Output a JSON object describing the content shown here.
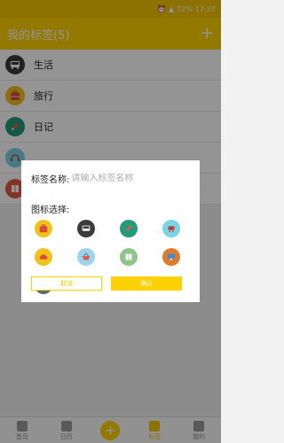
{
  "status_bar": {
    "battery": "72%",
    "time": "17:27"
  },
  "app_bar": {
    "title": "我的标签(5)",
    "add_icon": "+"
  },
  "tags": [
    {
      "label": "生活",
      "icon": "bus-icon",
      "color": "#3b3b3b"
    },
    {
      "label": "旅行",
      "icon": "suitcase-icon",
      "color": "#f2c21a"
    },
    {
      "label": "日记",
      "icon": "pencil-icon",
      "color": "#1f9c7a"
    },
    {
      "label": "",
      "icon": "headphones-icon",
      "color": "#7bd3e6"
    },
    {
      "label": "",
      "icon": "book-icon",
      "color": "#e05a44"
    }
  ],
  "dialog": {
    "name_label": "标签名称:",
    "name_placeholder": "请输入标签名称",
    "name_value": "",
    "icon_heading": "图标选择:",
    "icons": [
      {
        "name": "suitcase-icon",
        "color": "#f2c21a"
      },
      {
        "name": "bus-icon",
        "color": "#3b3b3b"
      },
      {
        "name": "pencil-icon",
        "color": "#1f9c7a"
      },
      {
        "name": "shopping-cart-icon",
        "color": "#7bd3e6"
      },
      {
        "name": "car-icon",
        "color": "#f2c21a"
      },
      {
        "name": "basket-icon",
        "color": "#9ed3f0"
      },
      {
        "name": "book-icon",
        "color": "#8fc48a"
      },
      {
        "name": "monitor-icon",
        "color": "#e07a2c"
      },
      {
        "name": "link-icon",
        "color": "#5a6b7a"
      }
    ],
    "cancel_label": "取消",
    "confirm_label": "确认"
  },
  "tabs": [
    {
      "label": "首页",
      "icon": "home-icon"
    },
    {
      "label": "日历",
      "icon": "calendar-icon"
    },
    {
      "label": "+",
      "icon": "plus-icon"
    },
    {
      "label": "标签",
      "icon": "tag-icon",
      "active": true
    },
    {
      "label": "我的",
      "icon": "profile-icon"
    }
  ],
  "colors": {
    "accent": "#fdd000",
    "overlay": "rgba(0,0,0,0.42)"
  }
}
